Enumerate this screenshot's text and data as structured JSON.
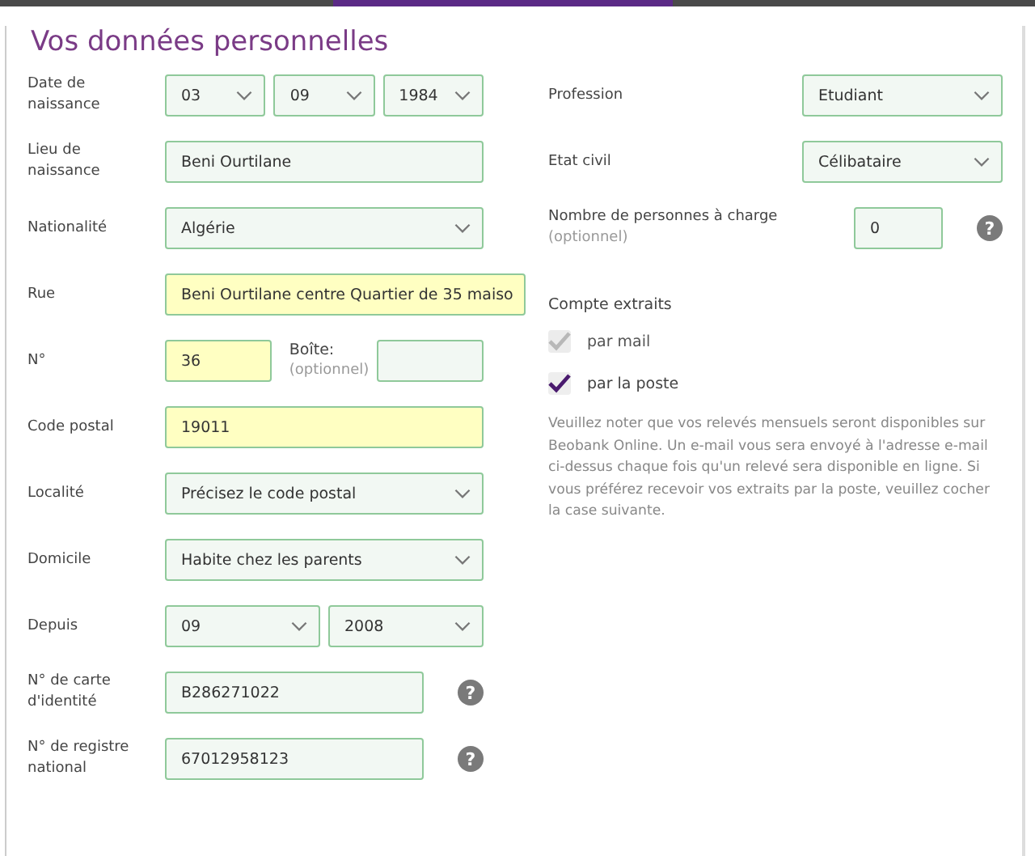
{
  "title": "Vos données personnelles",
  "left_fields": [
    {
      "label": "Date de naissance",
      "controls": [
        {
          "kind": "select",
          "value": "03",
          "highlighted": false
        },
        {
          "kind": "select",
          "value": "09",
          "highlighted": false
        },
        {
          "kind": "select",
          "value": "1984",
          "highlighted": false
        }
      ]
    },
    {
      "label": "Lieu de naissance",
      "controls": [
        {
          "kind": "input",
          "value": "Beni Ourtilane",
          "highlighted": false
        }
      ]
    },
    {
      "label": "Nationalité",
      "controls": [
        {
          "kind": "select",
          "value": "Algérie",
          "highlighted": false
        }
      ]
    },
    {
      "label": "Rue",
      "controls": [
        {
          "kind": "input",
          "value": "Beni Ourtilane centre Quartier de 35 maiso",
          "highlighted": true
        }
      ]
    },
    {
      "label": "N°",
      "controls": [
        {
          "kind": "input",
          "value": "36",
          "highlighted": true
        },
        {
          "kind": "sublabel",
          "value": "Boîte:",
          "note": "(optionnel)"
        },
        {
          "kind": "input",
          "highlighted": false
        }
      ]
    },
    {
      "label": "Code postal",
      "controls": [
        {
          "kind": "input",
          "value": "19011",
          "highlighted": true
        }
      ]
    },
    {
      "label": "Localité",
      "controls": [
        {
          "kind": "select",
          "value": "Précisez le code postal",
          "highlighted": false
        }
      ]
    },
    {
      "label": "Domicile",
      "controls": [
        {
          "kind": "select",
          "value": "Habite chez les parents",
          "highlighted": false
        }
      ]
    },
    {
      "label": "Depuis",
      "controls": [
        {
          "kind": "select",
          "value": "09",
          "highlighted": false
        },
        {
          "kind": "select",
          "value": "2008",
          "highlighted": false
        }
      ]
    },
    {
      "label": "N° de carte d'identité",
      "help": "?",
      "controls": [
        {
          "kind": "input",
          "value": "B286271022",
          "highlighted": false
        }
      ]
    },
    {
      "label": "N° de registre national",
      "help": "?",
      "controls": [
        {
          "kind": "input",
          "value": "67012958123",
          "highlighted": false
        }
      ]
    }
  ],
  "right_fields": [
    {
      "label": "Profession",
      "controls": [
        {
          "kind": "select",
          "value": "Etudiant",
          "highlighted": false
        }
      ]
    },
    {
      "label": "Etat civil",
      "controls": [
        {
          "kind": "select",
          "value": "Célibataire",
          "highlighted": false
        }
      ]
    },
    {
      "label": "Nombre de personnes à charge",
      "note": "(optionnel)",
      "help": "?",
      "controls": [
        {
          "kind": "number",
          "value": "0",
          "highlighted": false
        }
      ]
    }
  ],
  "statements": {
    "heading": "Compte extraits",
    "options": [
      {
        "label": "par mail",
        "checked": true,
        "disabled": true
      },
      {
        "label": "par la poste",
        "checked": true,
        "disabled": false
      }
    ],
    "note": "Veuillez noter que vos relevés mensuels seront disponibles sur Beobank Online. Un e-mail vous sera envoyé à l'adresse e-mail ci-dessus chaque fois qu'un relevé sera disponible en ligne. Si vous préférez recevoir vos extraits par la poste, veuillez cocher la case suivante."
  }
}
